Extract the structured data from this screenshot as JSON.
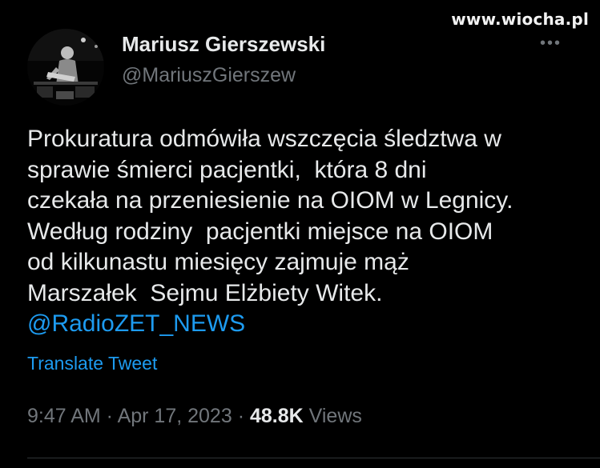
{
  "watermark": "www.wiocha.pl",
  "more_menu": {
    "icon": "more-horizontal-icon",
    "glyph": "•••"
  },
  "author": {
    "name": "Mariusz Gierszewski",
    "handle": "@MariuszGierszew",
    "avatar": "profile-photo"
  },
  "tweet": {
    "lines": [
      "Prokuratura odmówiła wszczęcia śledztwa w",
      "sprawie śmierci pacjentki,  która 8 dni",
      "czekała na przeniesienie na OIOM w Legnicy.",
      "Według rodziny  pacjentki miejsce na OIOM",
      "od kilkunastu miesięcy zajmuje mąż",
      "Marszałek  Sejmu Elżbiety Witek."
    ],
    "mention": "@RadioZET_NEWS"
  },
  "translate_label": "Translate Tweet",
  "meta": {
    "time": "9:47 AM",
    "separator": " · ",
    "date": "Apr 17, 2023",
    "views_count": "48.8K",
    "views_label": "Views"
  },
  "colors": {
    "background": "#000000",
    "text": "#e7e9ea",
    "muted": "#71767b",
    "link": "#1d9bf0",
    "divider": "#2f3336"
  }
}
